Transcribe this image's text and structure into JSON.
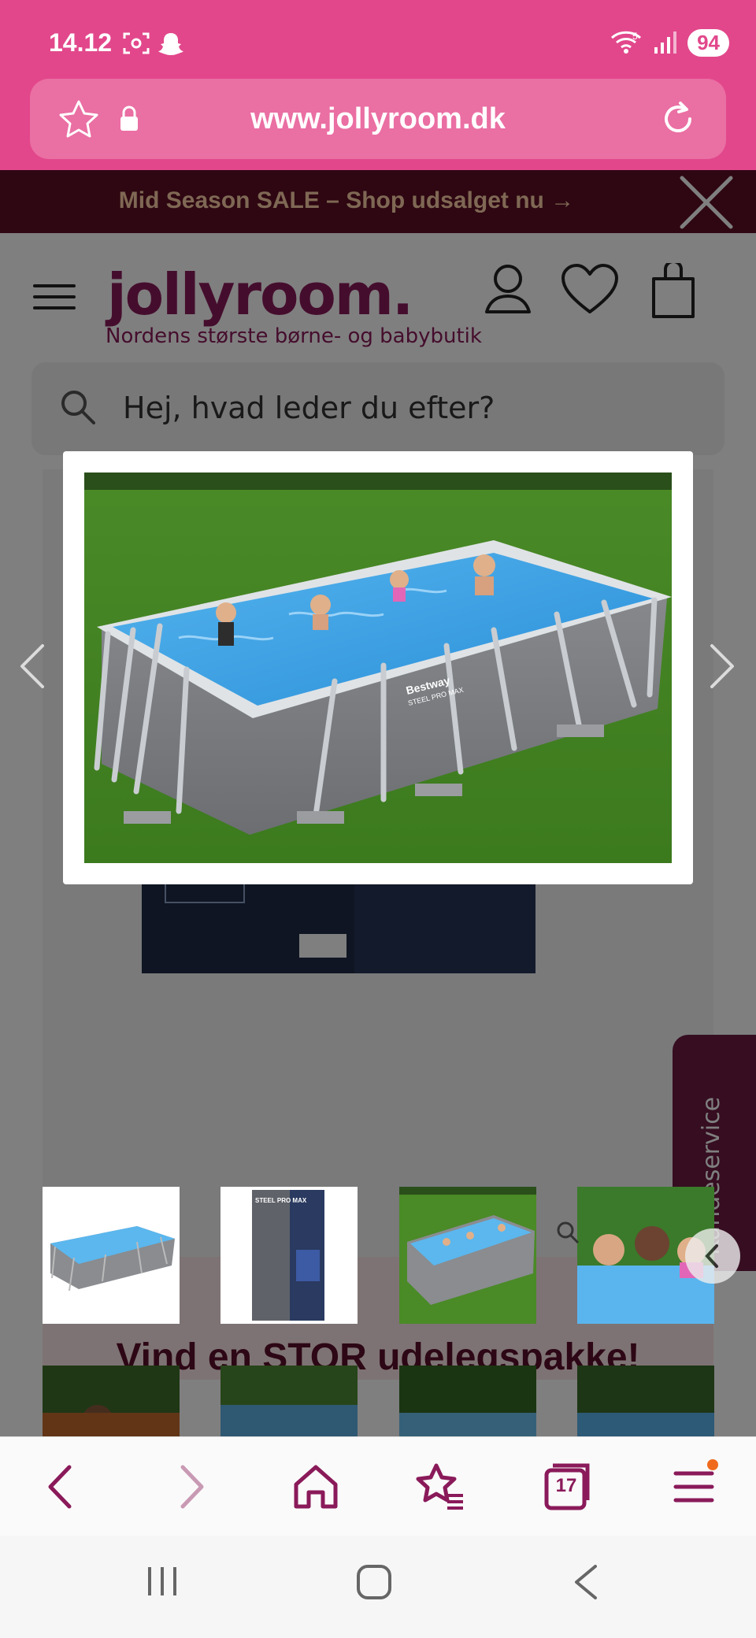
{
  "status_bar": {
    "time": "14.12",
    "network": "5",
    "battery": "94"
  },
  "browser": {
    "url": "www.jollyroom.dk",
    "tab_count": "17"
  },
  "promo": {
    "text": "Mid Season SALE – Shop udsalget nu →"
  },
  "site": {
    "logo": "jollyroom.",
    "tagline": "Nordens største børne- og babybutik",
    "search_placeholder": "Hej, hvad leder du efter?"
  },
  "product_page": {
    "box_brand": "STEEL PRO MAX",
    "pool_brand": "Bestway",
    "pool_model": "STEEL PRO MAX",
    "kundeservice_label": "Kundeservice",
    "banner_text": "Vind en STOR udelegspakke!"
  },
  "colors": {
    "status_pink": "#e2478b",
    "brand_plum": "#8a1a5a",
    "promo_bg": "#5c0f24",
    "notification_dot": "#f06a1e"
  }
}
